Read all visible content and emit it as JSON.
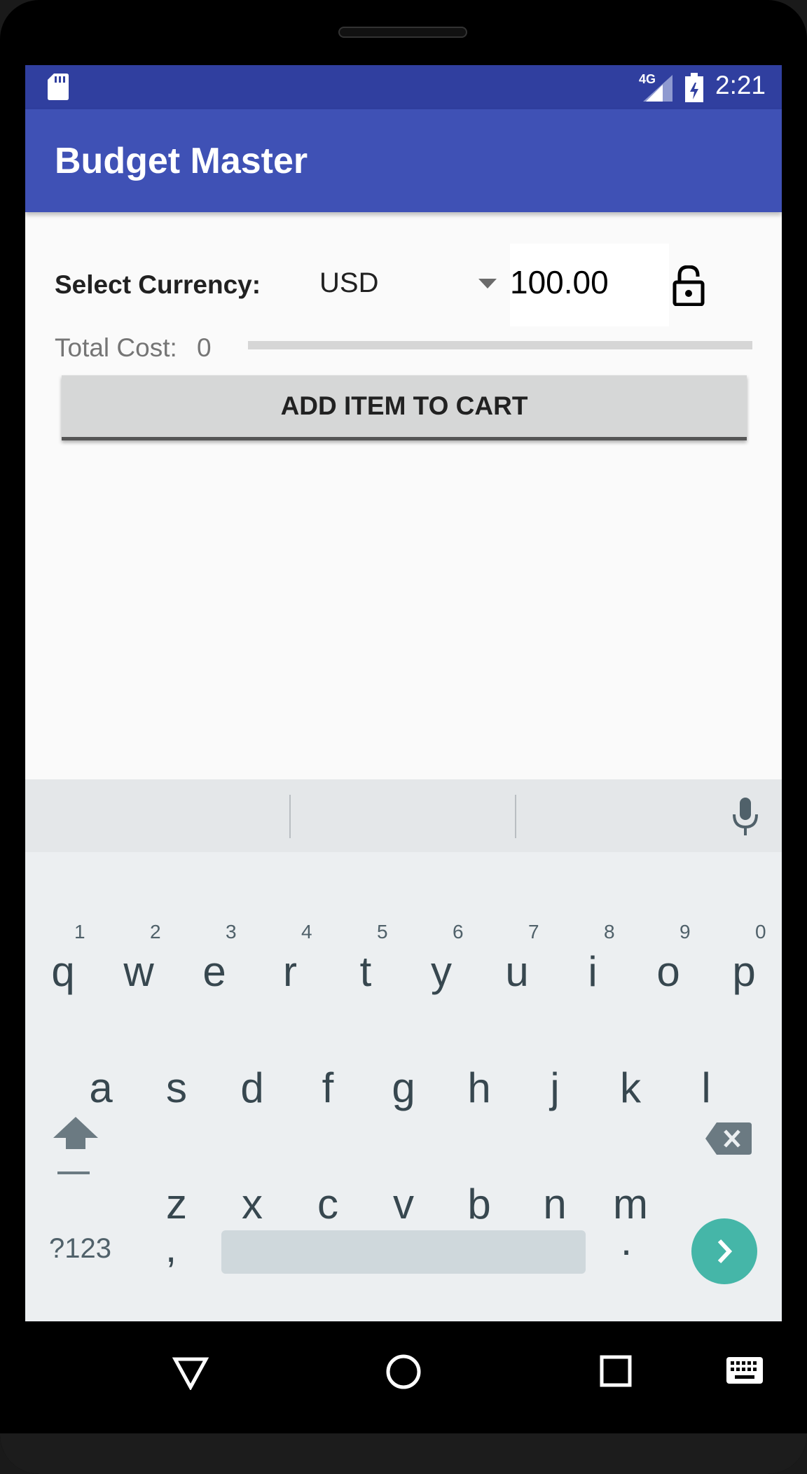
{
  "status_bar": {
    "network": "4G",
    "time": "2:21"
  },
  "app_bar": {
    "title": "Budget Master"
  },
  "form": {
    "currency_label": "Select Currency:",
    "currency_value": "USD",
    "amount_value": "100.00",
    "total_label": "Total Cost:",
    "total_value": "0",
    "budget_progress_fraction": 0,
    "add_button_label": "ADD ITEM TO CART"
  },
  "keyboard": {
    "row1": [
      "q",
      "w",
      "e",
      "r",
      "t",
      "y",
      "u",
      "i",
      "o",
      "p"
    ],
    "row1_hints": [
      "1",
      "2",
      "3",
      "4",
      "5",
      "6",
      "7",
      "8",
      "9",
      "0"
    ],
    "row2": [
      "a",
      "s",
      "d",
      "f",
      "g",
      "h",
      "j",
      "k",
      "l"
    ],
    "row3": [
      "z",
      "x",
      "c",
      "v",
      "b",
      "n",
      "m"
    ],
    "symbols_key": "?123",
    "comma_key": ",",
    "period_key": ".",
    "accent_color": "#45b6a8"
  },
  "icons": {
    "status": [
      "sd-card-icon",
      "signal-icon",
      "battery-icon"
    ],
    "form": [
      "dropdown-arrow-icon",
      "lock-open-icon"
    ],
    "keyboard": [
      "mic-icon",
      "shift-icon",
      "backspace-icon",
      "go-arrow-icon"
    ],
    "nav": [
      "back-icon",
      "home-icon",
      "recents-icon",
      "keyboard-switch-icon"
    ]
  },
  "colors": {
    "status_bar": "#303f9f",
    "app_bar": "#3f51b5",
    "background": "#fafafa"
  }
}
